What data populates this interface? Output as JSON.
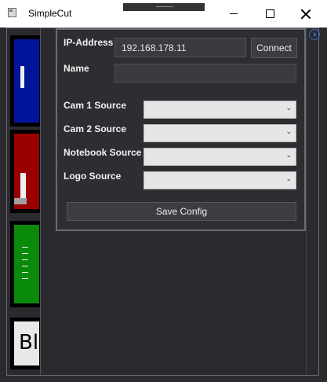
{
  "window": {
    "title": "SimpleCut",
    "icons": {
      "app": "app-window-icon",
      "minimize": "minimize-icon",
      "maximize": "maximize-icon",
      "close": "close-icon"
    }
  },
  "sources": [
    {
      "name": "source-1",
      "color": "#00159a"
    },
    {
      "name": "source-2",
      "color": "#9a0000"
    },
    {
      "name": "source-3",
      "color": "#0a8a0a"
    },
    {
      "name": "source-4",
      "color": "#e8e8e8",
      "text": "Bl"
    }
  ],
  "config": {
    "ip_label": "IP-Address",
    "ip_value": "192.168.178.11",
    "connect_label": "Connect",
    "name_label": "Name",
    "name_value": "",
    "cam1_label": "Cam 1 Source",
    "cam1_value": "",
    "cam2_label": "Cam 2 Source",
    "cam2_value": "",
    "notebook_label": "Notebook Source",
    "notebook_value": "",
    "logo_label": "Logo Source",
    "logo_value": "",
    "dropdown_glyph": "⌄",
    "save_label": "Save Config"
  },
  "colors": {
    "background": "#2b2b2f",
    "panel_border": "#6b6b72",
    "accent": "#3a67c8"
  }
}
